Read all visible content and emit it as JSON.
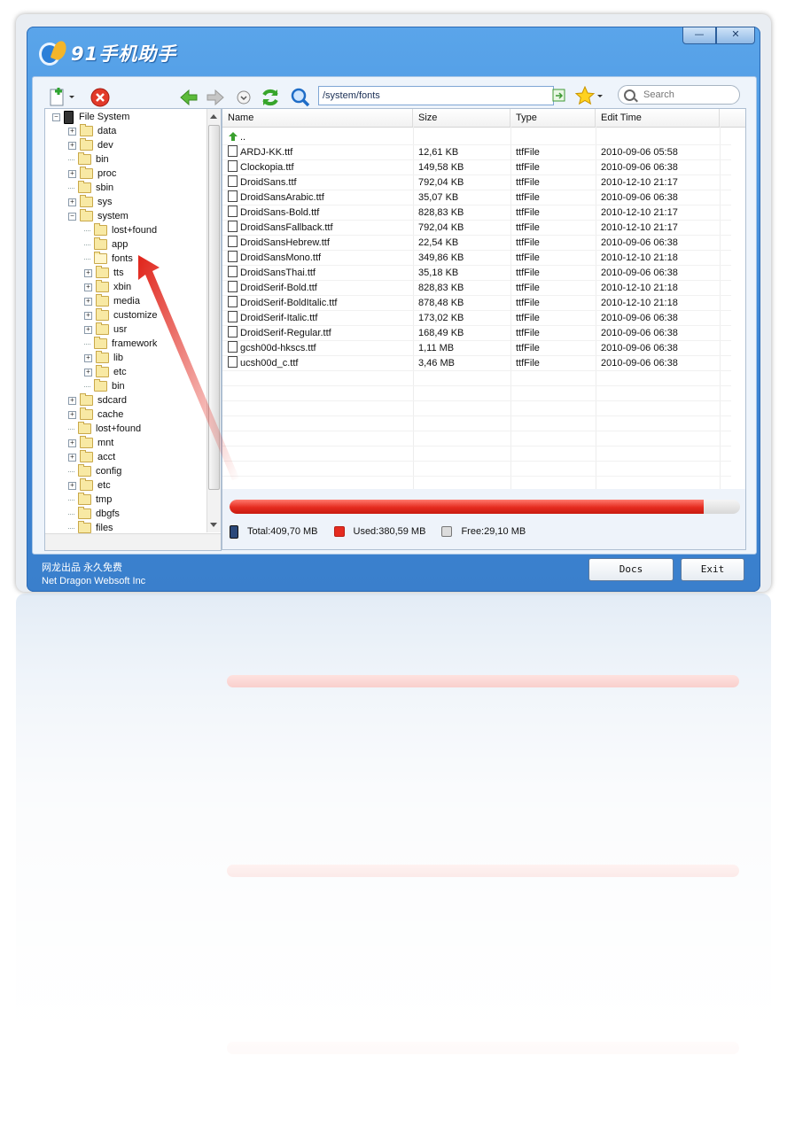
{
  "app": {
    "title": "91手机助手",
    "min_label": "—",
    "close_label": "✕"
  },
  "toolbar": {
    "path": "/system/fonts",
    "search_placeholder": "Search"
  },
  "tree": {
    "items": [
      {
        "label": "File System",
        "level": 0,
        "expander": "−",
        "icon": "phone"
      },
      {
        "label": "data",
        "level": 1,
        "expander": "+"
      },
      {
        "label": "dev",
        "level": 1,
        "expander": "+"
      },
      {
        "label": "bin",
        "level": 1,
        "expander": ""
      },
      {
        "label": "proc",
        "level": 1,
        "expander": "+"
      },
      {
        "label": "sbin",
        "level": 1,
        "expander": ""
      },
      {
        "label": "sys",
        "level": 1,
        "expander": "+"
      },
      {
        "label": "system",
        "level": 1,
        "expander": "−"
      },
      {
        "label": "lost+found",
        "level": 2,
        "expander": ""
      },
      {
        "label": "app",
        "level": 2,
        "expander": ""
      },
      {
        "label": "fonts",
        "level": 2,
        "expander": "",
        "open": true
      },
      {
        "label": "tts",
        "level": 2,
        "expander": "+"
      },
      {
        "label": "xbin",
        "level": 2,
        "expander": "+"
      },
      {
        "label": "media",
        "level": 2,
        "expander": "+"
      },
      {
        "label": "customize",
        "level": 2,
        "expander": "+"
      },
      {
        "label": "usr",
        "level": 2,
        "expander": "+"
      },
      {
        "label": "framework",
        "level": 2,
        "expander": ""
      },
      {
        "label": "lib",
        "level": 2,
        "expander": "+"
      },
      {
        "label": "etc",
        "level": 2,
        "expander": "+"
      },
      {
        "label": "bin",
        "level": 2,
        "expander": ""
      },
      {
        "label": "sdcard",
        "level": 1,
        "expander": "+"
      },
      {
        "label": "cache",
        "level": 1,
        "expander": "+"
      },
      {
        "label": "lost+found",
        "level": 1,
        "expander": ""
      },
      {
        "label": "mnt",
        "level": 1,
        "expander": "+"
      },
      {
        "label": "acct",
        "level": 1,
        "expander": "+"
      },
      {
        "label": "config",
        "level": 1,
        "expander": ""
      },
      {
        "label": "etc",
        "level": 1,
        "expander": "+"
      },
      {
        "label": "tmp",
        "level": 1,
        "expander": ""
      },
      {
        "label": "dbgfs",
        "level": 1,
        "expander": ""
      },
      {
        "label": "files",
        "level": 1,
        "expander": ""
      }
    ]
  },
  "list": {
    "columns": {
      "name": "Name",
      "size": "Size",
      "type": "Type",
      "time": "Edit Time"
    },
    "up_label": "..",
    "rows": [
      {
        "name": "ARDJ-KK.ttf",
        "size": "12,61 KB",
        "type": "ttfFile",
        "time": "2010-09-06 05:58"
      },
      {
        "name": "Clockopia.ttf",
        "size": "149,58 KB",
        "type": "ttfFile",
        "time": "2010-09-06 06:38"
      },
      {
        "name": "DroidSans.ttf",
        "size": "792,04 KB",
        "type": "ttfFile",
        "time": "2010-12-10 21:17"
      },
      {
        "name": "DroidSansArabic.ttf",
        "size": "35,07 KB",
        "type": "ttfFile",
        "time": "2010-09-06 06:38"
      },
      {
        "name": "DroidSans-Bold.ttf",
        "size": "828,83 KB",
        "type": "ttfFile",
        "time": "2010-12-10 21:17"
      },
      {
        "name": "DroidSansFallback.ttf",
        "size": "792,04 KB",
        "type": "ttfFile",
        "time": "2010-12-10 21:17"
      },
      {
        "name": "DroidSansHebrew.ttf",
        "size": "22,54 KB",
        "type": "ttfFile",
        "time": "2010-09-06 06:38"
      },
      {
        "name": "DroidSansMono.ttf",
        "size": "349,86 KB",
        "type": "ttfFile",
        "time": "2010-12-10 21:18"
      },
      {
        "name": "DroidSansThai.ttf",
        "size": "35,18 KB",
        "type": "ttfFile",
        "time": "2010-09-06 06:38"
      },
      {
        "name": "DroidSerif-Bold.ttf",
        "size": "828,83 KB",
        "type": "ttfFile",
        "time": "2010-12-10 21:18"
      },
      {
        "name": "DroidSerif-BoldItalic.ttf",
        "size": "878,48 KB",
        "type": "ttfFile",
        "time": "2010-12-10 21:18"
      },
      {
        "name": "DroidSerif-Italic.ttf",
        "size": "173,02 KB",
        "type": "ttfFile",
        "time": "2010-09-06 06:38"
      },
      {
        "name": "DroidSerif-Regular.ttf",
        "size": "168,49 KB",
        "type": "ttfFile",
        "time": "2010-09-06 06:38"
      },
      {
        "name": "gcsh00d-hkscs.ttf",
        "size": "1,11 MB",
        "type": "ttfFile",
        "time": "2010-09-06 06:38"
      },
      {
        "name": "ucsh00d_c.ttf",
        "size": "3,46 MB",
        "type": "ttfFile",
        "time": "2010-09-06 06:38"
      }
    ]
  },
  "storage": {
    "used_fraction": 0.929,
    "total": "Total:409,70 MB",
    "used": "Used:380,59 MB",
    "free": "Free:29,10 MB",
    "used_color": "#e52b1f",
    "free_color": "#d9d9d9"
  },
  "footer": {
    "line1": "网龙出品 永久免费",
    "line2": "Net Dragon Websoft Inc",
    "docs": "Docs",
    "exit": "Exit"
  },
  "colors": {
    "titlebar": "#3c86d6",
    "accent": "#e52b1f"
  }
}
